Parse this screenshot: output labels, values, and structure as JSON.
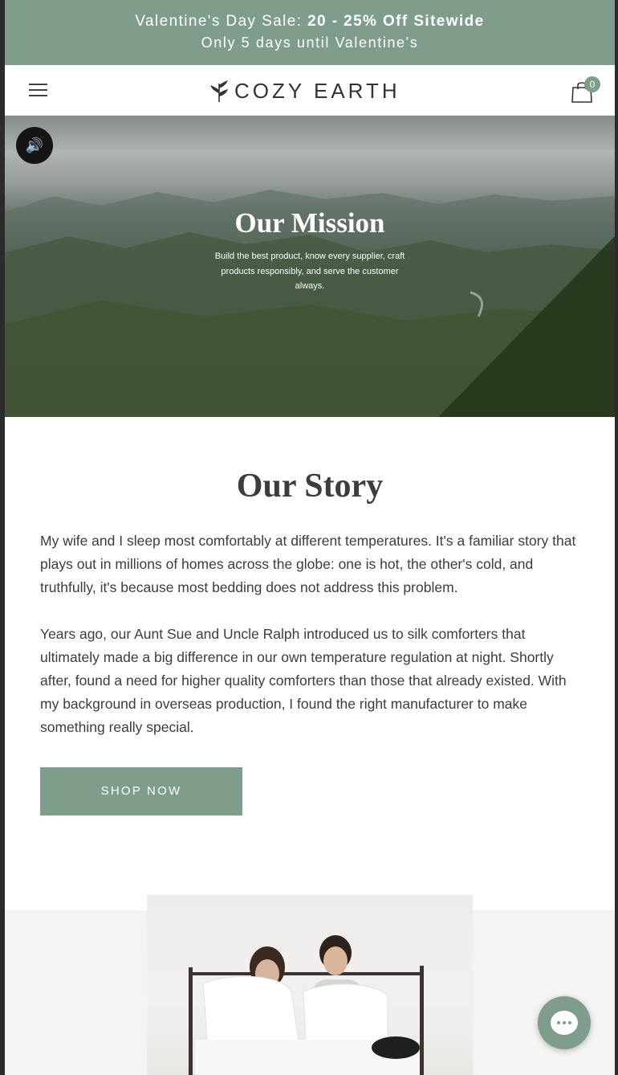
{
  "promo": {
    "prefix": "Valentine's Day Sale: ",
    "highlight": "20 - 25% Off Sitewide",
    "line2": "Only 5 days until Valentine's"
  },
  "header": {
    "brand": "COZY EARTH",
    "cart_count": "0"
  },
  "hero": {
    "sound_icon": "speaker-volume-icon",
    "title": "Our Mission",
    "subtitle": "Build the best product, know every supplier, craft products responsibly, and serve the customer always."
  },
  "story": {
    "title": "Our Story",
    "p1": "My wife and I sleep most comfortably at different temperatures. It's a familiar story that plays out in millions of homes across the globe: one is hot, the other's cold, and truthfully, it's because most bedding does not address this problem.",
    "p2": "Years ago, our Aunt Sue and Uncle Ralph introduced us to silk comforters that ultimately made a big difference in our own temperature regulation at night. Shortly after, found a need for higher quality comforters than those that already existed. With my background in overseas production, I found the right manufacturer to make something really special.",
    "cta": "SHOP NOW"
  },
  "colors": {
    "accent": "#7f9d8b",
    "text": "#3d3d3d"
  },
  "icons": {
    "menu": "hamburger-icon",
    "logo": "leaf-logo-icon",
    "cart": "shopping-bag-icon",
    "chat": "chat-bubble-icon"
  }
}
